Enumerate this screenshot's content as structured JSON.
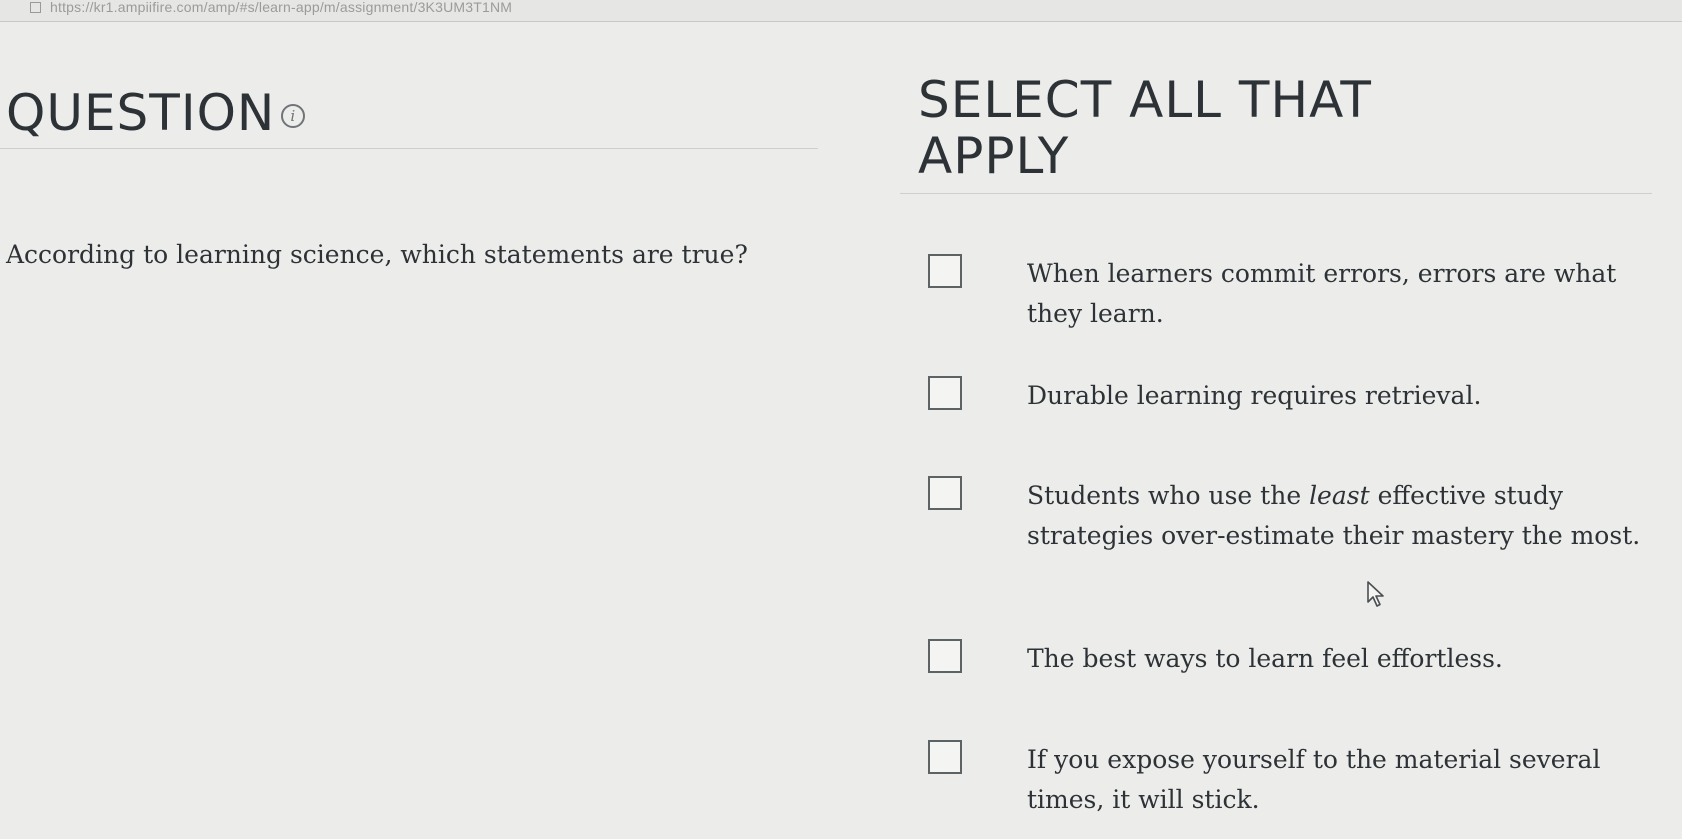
{
  "browser": {
    "url": "https://kr1.ampiifire.com/amp/#s/learn-app/m/assignment/3K3UM3T1NM"
  },
  "question": {
    "title": "QUESTION",
    "info_icon_glyph": "i",
    "prompt": "According to learning science, which statements are true?"
  },
  "instructions": {
    "title": "SELECT ALL THAT APPLY"
  },
  "options": [
    {
      "text": "When learners commit errors, errors are what they learn.",
      "checked": false
    },
    {
      "text": "Durable learning requires retrieval.",
      "checked": false
    },
    {
      "text_before": "Students who use the ",
      "text_emphasis": "least",
      "text_after": " effective study strategies over-estimate their mastery the most.",
      "checked": false
    },
    {
      "text": "The best ways to learn feel effortless.",
      "checked": false
    },
    {
      "text": "If you expose yourself to the material several times, it will stick.",
      "checked": false
    }
  ],
  "colors": {
    "background": "#ececeb",
    "text": "#2d3236",
    "checkbox_border": "#5d6264",
    "divider": "#cfcfcc"
  }
}
